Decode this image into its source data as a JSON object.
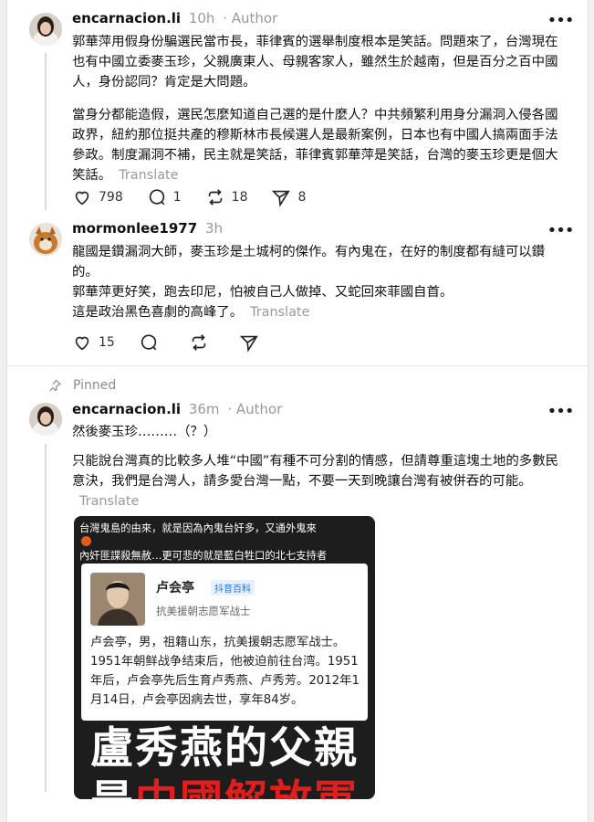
{
  "posts": [
    {
      "username": "encarnacion.li",
      "time": "10h",
      "author_tag": "· Author",
      "paragraphs": [
        "郭華萍用假身份騙選民當市長，菲律賓的選舉制度根本是笑話。問題來了，台灣現在也有中國立委麥玉珍，父親廣東人、母親客家人，雖然生於越南，但是百分之百中國人，身份認同？肯定是大問題。",
        "當身分都能造假，選民怎麼知道自己選的是什麼人？中共頻繁利用身分漏洞入侵各國政界，紐約那位挺共產的穆斯林市長候選人是最新案例，日本也有中國人搞兩面手法參政。制度漏洞不補，民主就是笑話，菲律賓郭華萍是笑話，台灣的麥玉珍更是個大笑話。"
      ],
      "translate": "Translate",
      "likes": "798",
      "comments": "1",
      "reposts": "18",
      "shares": "8"
    },
    {
      "username": "mormonlee1977",
      "time": "3h",
      "paragraphs": [
        "龍國是鑽漏洞大師，麥玉珍是土城柯的傑作。有內鬼在，在好的制度都有縫可以鑽的。",
        "郭華萍更好笑，跑去印尼，怕被自己人做掉、又蛇回來菲國自首。",
        "這是政治黑色喜劇的高峰了。"
      ],
      "translate": "Translate",
      "likes": "15"
    },
    {
      "pinned_label": "Pinned",
      "username": "encarnacion.li",
      "time": "36m",
      "author_tag": "· Author",
      "paragraphs": [
        "然後麥玉珍………（？）",
        "只能說台灣真的比較多人堆“中國”有種不可分割的情感，但請尊重這塊土地的多數民意決，我們是台灣人，請多愛台灣一點，不要一天到晚讓台灣有被併吞的可能。"
      ],
      "translate": "Translate",
      "image": {
        "caption_line1": "台灣鬼島的由來，就是因為內鬼台奸多，又通外鬼來",
        "caption_line2": "內奸匪諜殺無赦…更可悲的就是藍白牲口的北七支持者",
        "card_name": "卢会亭",
        "card_tag": "抖音百科",
        "card_sub": "抗美援朝志愿军战士",
        "card_text": "卢会亭，男，祖籍山东，抗美援朝志愿军战士。1951年朝鲜战争结束后，他被迫前往台湾。1951年后，卢会亭先后生育卢秀燕、卢秀芳。2012年1月14日，卢会亭因病去世，享年84岁。",
        "headline1": "盧秀燕的父親",
        "headline2_white": "是",
        "headline2_red": "中國解放軍"
      }
    }
  ]
}
